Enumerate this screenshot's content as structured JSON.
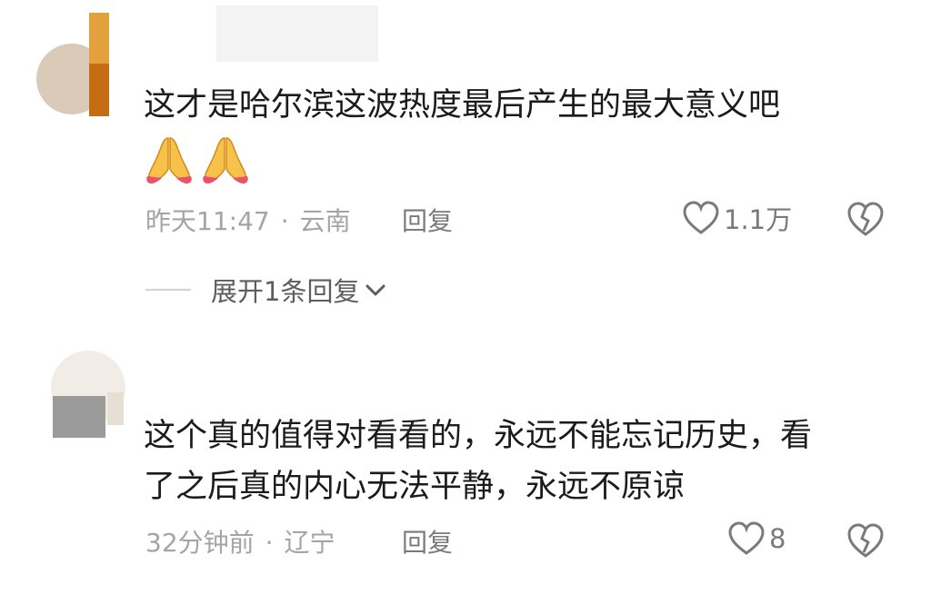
{
  "comments": [
    {
      "text_lines": [
        "这才是哈尔滨这波热度最后产生的最大意义吧"
      ],
      "emoji": [
        "folded-hands",
        "folded-hands"
      ],
      "time": "昨天11:47",
      "location": "云南",
      "separator": "·",
      "reply_label": "回复",
      "likes": "1.1万",
      "expand_label": "展开1条回复"
    },
    {
      "text_lines": [
        "这个真的值得对看看的，永远不能忘记历史，看",
        "了之后真的内心无法平静，永远不原谅"
      ],
      "time": "32分钟前",
      "location": "辽宁",
      "separator": "·",
      "reply_label": "回复",
      "likes": "8"
    }
  ],
  "colors": {
    "text": "#1b1b1b",
    "meta": "#a4a4a4",
    "action": "#7a7a7a",
    "avatar_mask_1a": "#e2a13c",
    "avatar_mask_1b": "#c46d12",
    "avatar_mask_2": "#9b9b9b"
  }
}
